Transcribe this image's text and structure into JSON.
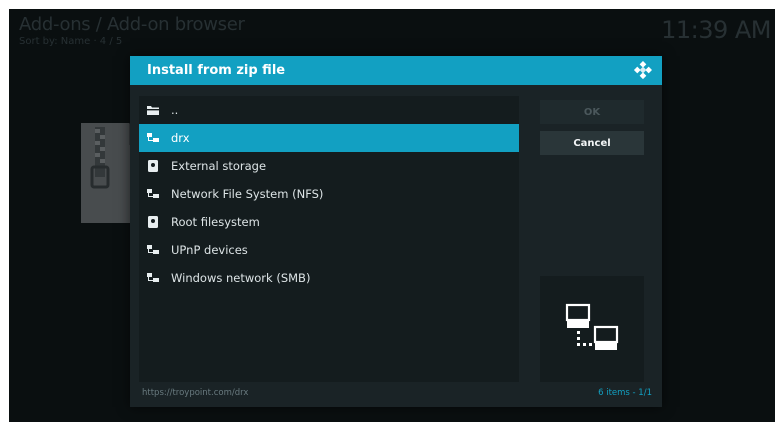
{
  "screen": {
    "title": "Add-ons / Add-on browser",
    "subtitle": "Sort by: Name  ·  4 / 5",
    "clock": "11:39 AM",
    "background_icon": "zip-file-icon"
  },
  "dialog": {
    "title": "Install from zip file",
    "logo_icon": "kodi-logo-icon",
    "items": [
      {
        "label": "..",
        "icon": "folder-icon",
        "focused": false
      },
      {
        "label": "drx",
        "icon": "network-icon",
        "focused": true
      },
      {
        "label": "External storage",
        "icon": "drive-icon",
        "focused": false
      },
      {
        "label": "Network File System (NFS)",
        "icon": "network-icon",
        "focused": false
      },
      {
        "label": "Root filesystem",
        "icon": "drive-icon",
        "focused": false
      },
      {
        "label": "UPnP devices",
        "icon": "network-icon",
        "focused": false
      },
      {
        "label": "Windows network (SMB)",
        "icon": "network-icon",
        "focused": false
      }
    ],
    "ok_label": "OK",
    "ok_enabled": false,
    "cancel_label": "Cancel",
    "preview_icon": "network-icon",
    "footer_path": "https://troypoint.com/drx",
    "footer_count": "6 items - 1/1"
  },
  "colors": {
    "accent": "#12a0c2",
    "background": "#101719",
    "dialog": "#1a2326"
  }
}
